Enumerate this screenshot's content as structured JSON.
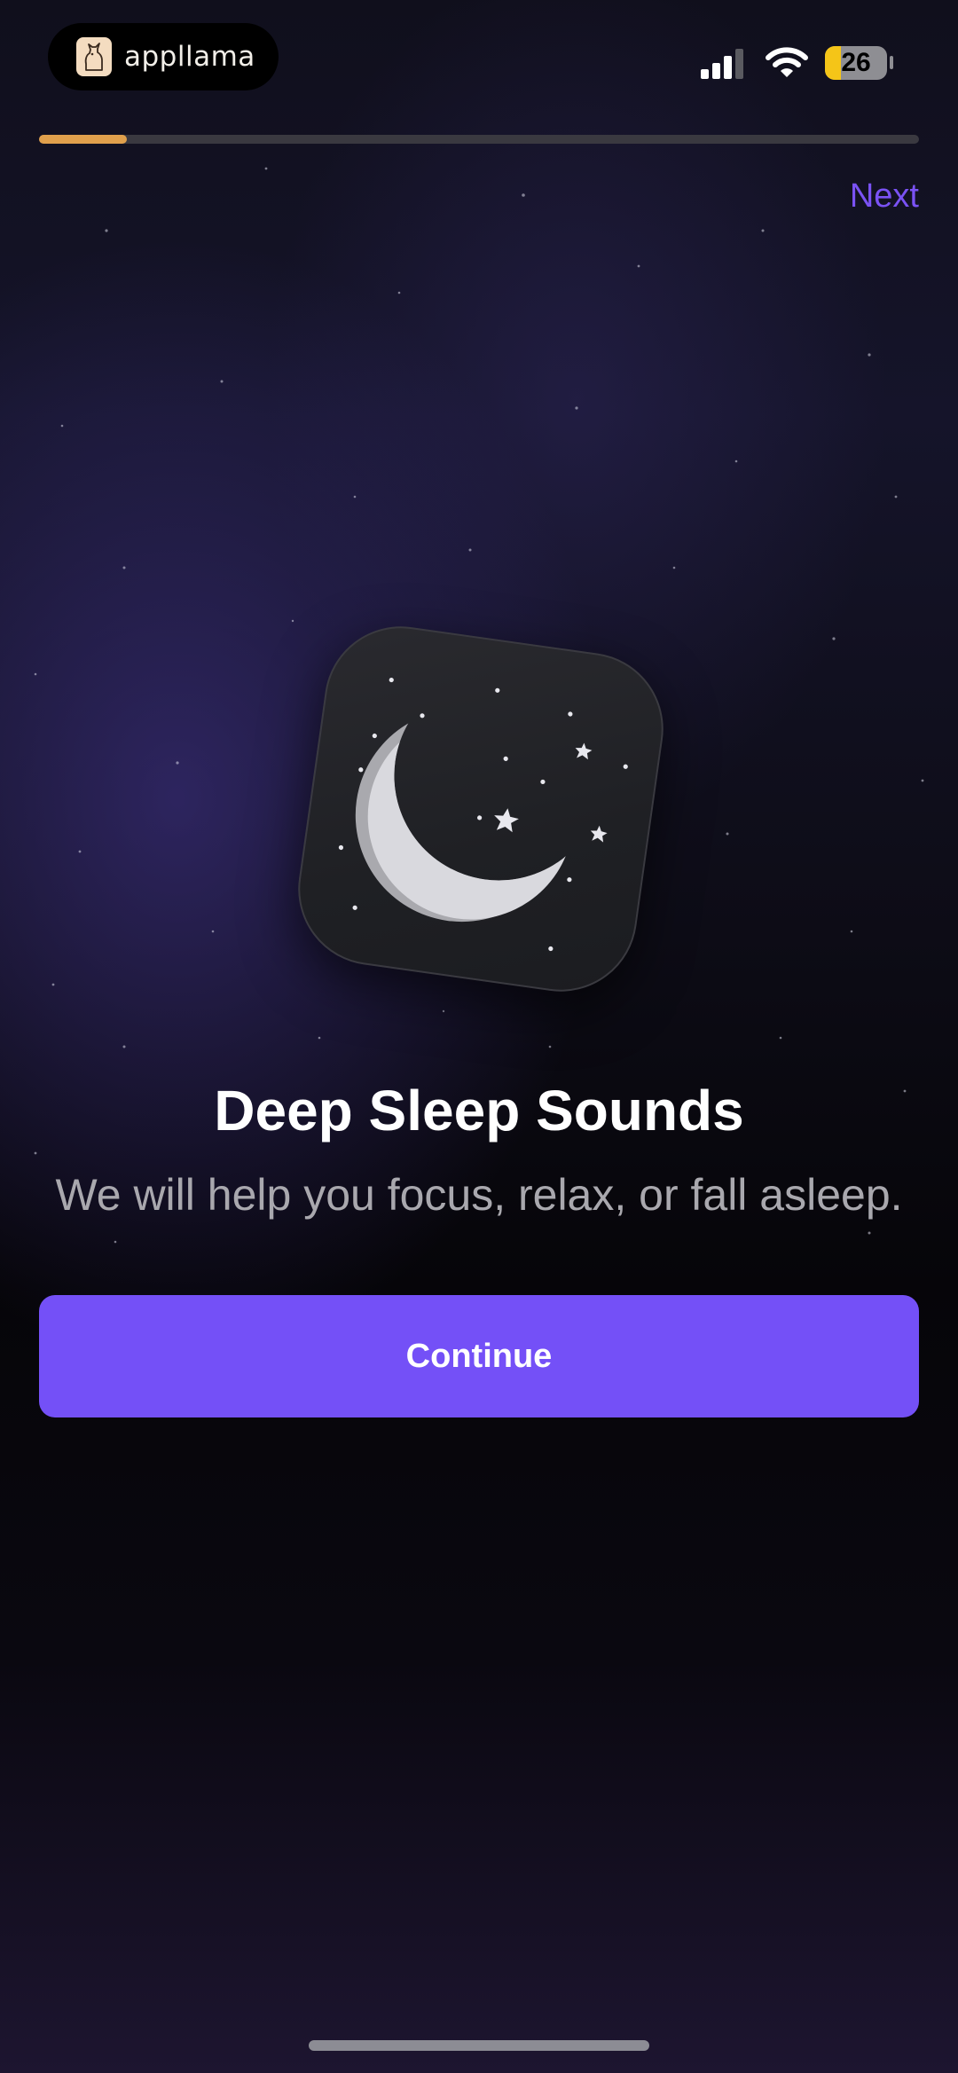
{
  "status_bar": {
    "brand_name": "appllama",
    "brand_icon": "llama-logo-icon",
    "battery_level": "26",
    "battery_fraction": 0.26,
    "battery_color": "#f5c518",
    "signal_icon": "cellular-signal-icon",
    "wifi_icon": "wifi-icon"
  },
  "onboarding": {
    "progress": 0.1,
    "progress_color": "#e0a04c",
    "next_label": "Next",
    "app_icon": "crescent-moon-stars-icon",
    "title": "Deep Sleep Sounds",
    "subtitle": "We will help you focus, relax, or fall asleep.",
    "continue_label": "Continue",
    "accent_color": "#7450f7"
  }
}
